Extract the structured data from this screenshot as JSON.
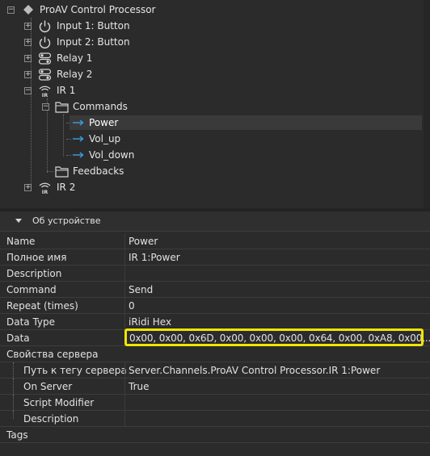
{
  "tree": {
    "root": "ProAV Control Processor",
    "items": [
      {
        "label": "Input 1: Button"
      },
      {
        "label": "Input 2: Button"
      },
      {
        "label": "Relay 1"
      },
      {
        "label": "Relay 2"
      },
      {
        "label": "IR 1"
      },
      {
        "label": "Commands"
      },
      {
        "label": "Power"
      },
      {
        "label": "Vol_up"
      },
      {
        "label": "Vol_down"
      },
      {
        "label": "Feedbacks"
      },
      {
        "label": "IR 2"
      }
    ]
  },
  "properties": {
    "section_title": "Об устройстве",
    "rows": [
      {
        "key": "Name",
        "value": "Power"
      },
      {
        "key": "Полное имя",
        "value": "IR 1:Power"
      },
      {
        "key": "Description",
        "value": ""
      },
      {
        "key": "Command",
        "value": "Send"
      },
      {
        "key": "Repeat (times)",
        "value": "0"
      },
      {
        "key": "Data Type",
        "value": "iRidi Hex"
      },
      {
        "key": "Data",
        "value": "0x00, 0x00, 0x6D, 0x00, 0x00, 0x00, 0x64, 0x00, 0xA8, 0x00,..."
      },
      {
        "key": "Свойства сервера",
        "value": ""
      },
      {
        "key": "Путь к тегу сервера",
        "value": "Server.Channels.ProAV Control Processor.IR 1:Power"
      },
      {
        "key": "On Server",
        "value": "True"
      },
      {
        "key": "Script Modifier",
        "value": ""
      },
      {
        "key": "Description",
        "value": ""
      },
      {
        "key": "Tags",
        "value": ""
      }
    ]
  },
  "colors": {
    "background": "#2b2b2b",
    "selection": "#3a3a3a",
    "highlight": "#f0e400",
    "command_arrow": "#3aa0e8"
  },
  "icons": {
    "root": "diamond-icon",
    "input": "power-icon",
    "relay": "relay-toggle-icon",
    "ir": "ir-emitter-icon",
    "folder": "folder-icon",
    "command": "arrow-right-icon"
  }
}
